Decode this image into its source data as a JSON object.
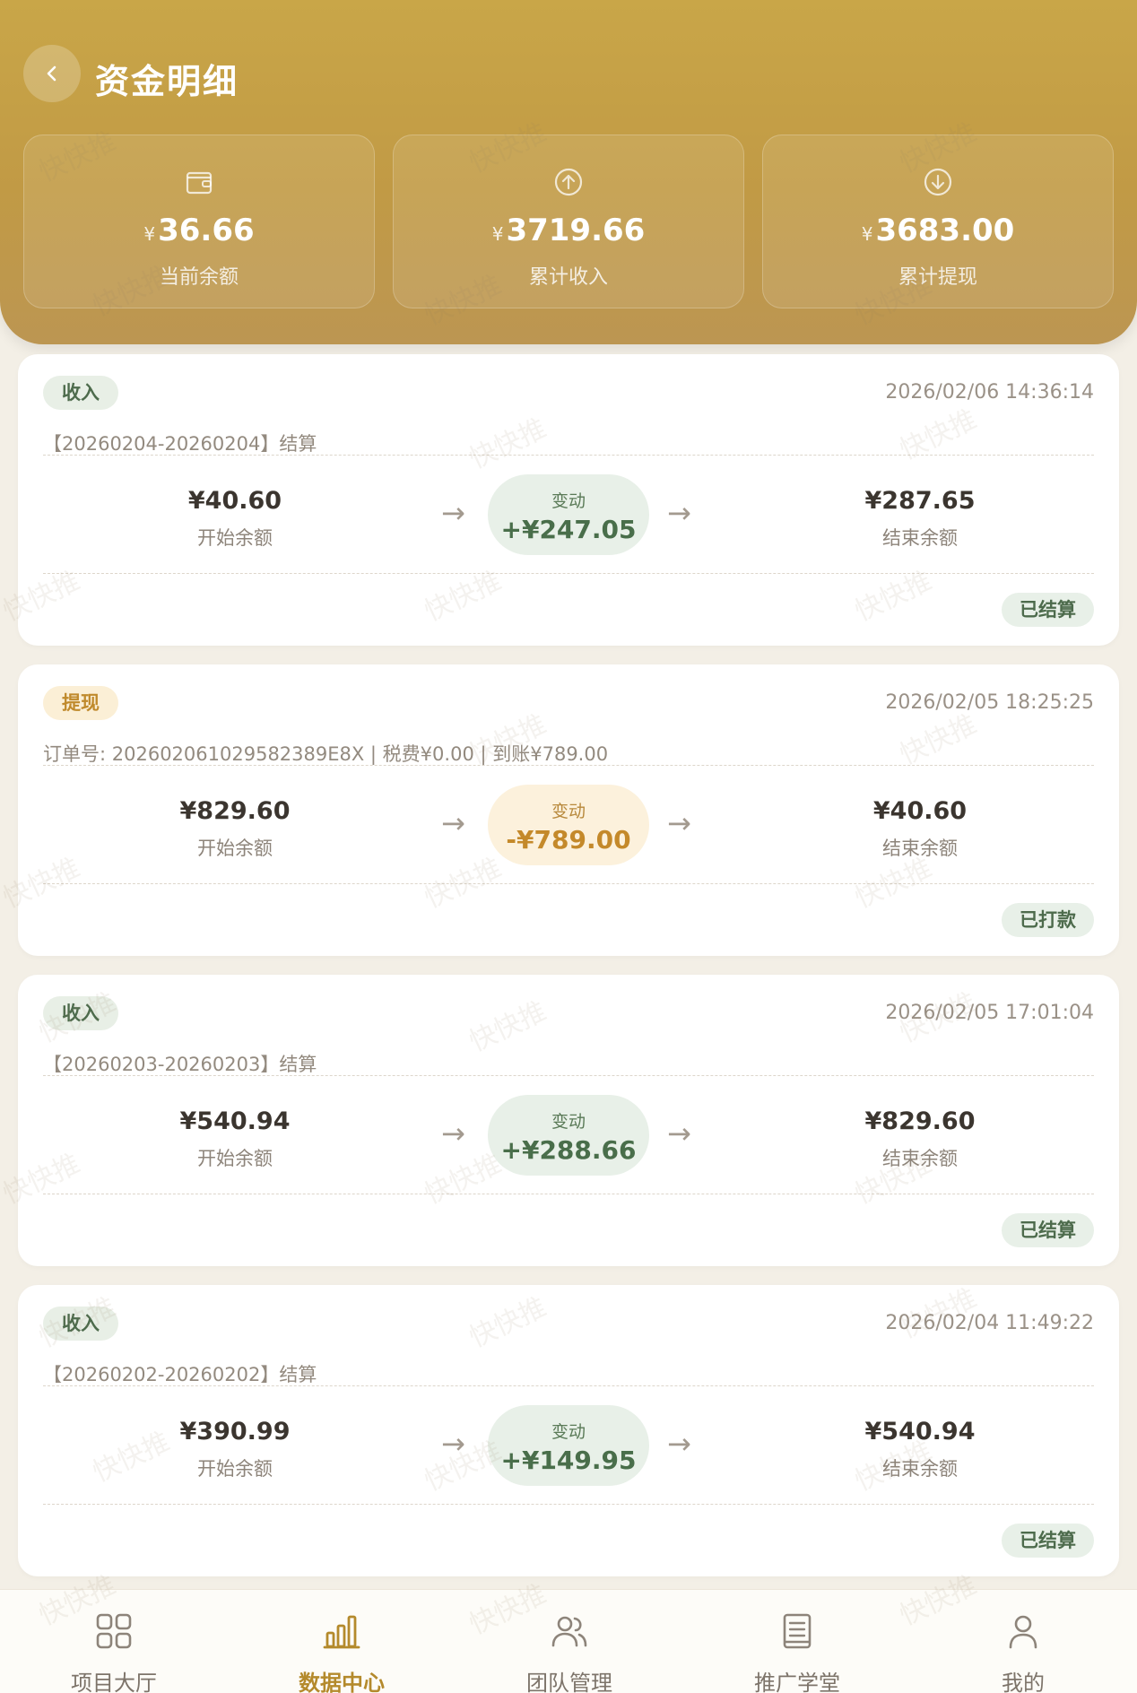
{
  "header": {
    "title": "资金明细",
    "stats": [
      {
        "icon": "wallet-icon",
        "currency": "¥",
        "amount": "36.66",
        "label": "当前余额"
      },
      {
        "icon": "arrow-up-circle-icon",
        "currency": "¥",
        "amount": "3719.66",
        "label": "累计收入"
      },
      {
        "icon": "arrow-down-circle-icon",
        "currency": "¥",
        "amount": "3683.00",
        "label": "累计提现"
      }
    ]
  },
  "records": [
    {
      "type": "收入",
      "kind": "income",
      "time": "2026/02/06 14:36:14",
      "desc": "【20260204-20260204】结算",
      "start_balance": "¥40.60",
      "start_label": "开始余额",
      "change_label": "变动",
      "change": "+¥247.05",
      "end_balance": "¥287.65",
      "end_label": "结束余额",
      "status": "已结算"
    },
    {
      "type": "提现",
      "kind": "withdraw",
      "time": "2026/02/05 18:25:25",
      "desc": "订单号: 202602061029582389E8X | 税费¥0.00 | 到账¥789.00",
      "start_balance": "¥829.60",
      "start_label": "开始余额",
      "change_label": "变动",
      "change": "-¥789.00",
      "end_balance": "¥40.60",
      "end_label": "结束余额",
      "status": "已打款"
    },
    {
      "type": "收入",
      "kind": "income",
      "time": "2026/02/05 17:01:04",
      "desc": "【20260203-20260203】结算",
      "start_balance": "¥540.94",
      "start_label": "开始余额",
      "change_label": "变动",
      "change": "+¥288.66",
      "end_balance": "¥829.60",
      "end_label": "结束余额",
      "status": "已结算"
    },
    {
      "type": "收入",
      "kind": "income",
      "time": "2026/02/04 11:49:22",
      "desc": "【20260202-20260202】结算",
      "start_balance": "¥390.99",
      "start_label": "开始余额",
      "change_label": "变动",
      "change": "+¥149.95",
      "end_balance": "¥540.94",
      "end_label": "结束余额",
      "status": "已结算"
    }
  ],
  "tabbar": {
    "items": [
      {
        "label": "项目大厅",
        "icon": "grid-icon",
        "active": false
      },
      {
        "label": "数据中心",
        "icon": "bar-chart-icon",
        "active": true
      },
      {
        "label": "团队管理",
        "icon": "users-icon",
        "active": false
      },
      {
        "label": "推广学堂",
        "icon": "book-icon",
        "active": false
      },
      {
        "label": "我的",
        "icon": "user-icon",
        "active": false
      }
    ]
  },
  "watermark": "快快推",
  "colors": {
    "header_gold": "#c19a45",
    "income_green": "#496e4a",
    "withdraw_orange": "#c4892a",
    "active_tab": "#b48a2c"
  }
}
